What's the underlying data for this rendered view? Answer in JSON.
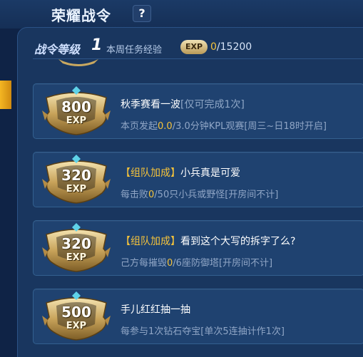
{
  "header": {
    "title": "荣耀战令",
    "help_label": "?"
  },
  "level": {
    "label": "战令等级",
    "number": "1",
    "weekly_label": "本周任务经验",
    "exp_badge": "EXP",
    "current": "0",
    "max": "/15200"
  },
  "tasks": [
    {
      "exp_value": "800",
      "exp_unit": "EXP",
      "tag": "",
      "title": "秋季赛看一波",
      "title_suffix": "[仅可完成1次]",
      "desc_prefix": "本页发起",
      "progress": "0.0",
      "desc_total": "/3.0分钟KPL观赛[周三~日18时开启]"
    },
    {
      "exp_value": "320",
      "exp_unit": "EXP",
      "tag": "【组队加成】",
      "title": "小兵真是可爱",
      "title_suffix": "",
      "desc_prefix": "每击败",
      "progress": "0",
      "desc_total": "/50只小兵或野怪[开房间不计]"
    },
    {
      "exp_value": "320",
      "exp_unit": "EXP",
      "tag": "【组队加成】",
      "title": "看到这个大写的拆字了么?",
      "title_suffix": "",
      "desc_prefix": "己方每摧毁",
      "progress": "0",
      "desc_total": "/6座防御塔[开房间不计]"
    },
    {
      "exp_value": "500",
      "exp_unit": "EXP",
      "tag": "",
      "title": "手儿红红抽一抽",
      "title_suffix": "",
      "desc_prefix": "每参与1次钻石夺宝[单次5连抽计作1次]",
      "progress": "",
      "desc_total": ""
    }
  ]
}
